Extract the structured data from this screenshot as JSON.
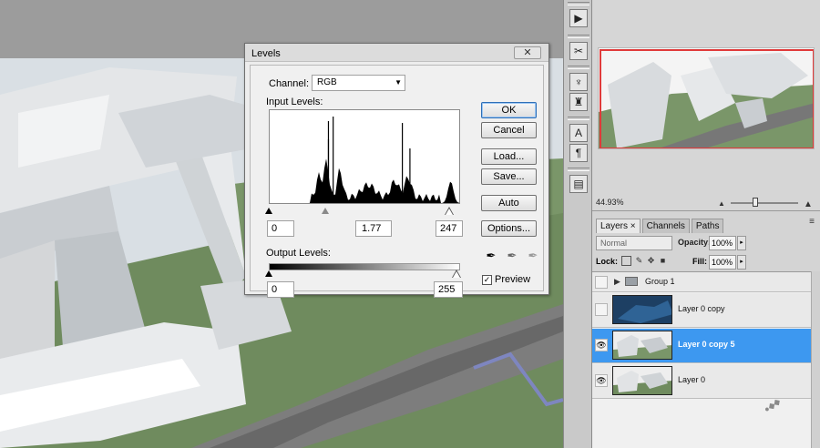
{
  "levels_dialog": {
    "title": "Levels",
    "close_glyph": "✕",
    "channel_label": "Channel:",
    "channel_value": "RGB",
    "input_levels_label": "Input Levels:",
    "input_black": "0",
    "input_gamma": "1.77",
    "input_white": "247",
    "output_levels_label": "Output Levels:",
    "output_black": "0",
    "output_white": "255",
    "buttons": {
      "ok": "OK",
      "cancel": "Cancel",
      "load": "Load...",
      "save": "Save...",
      "auto": "Auto",
      "options": "Options..."
    },
    "preview_label": "Preview",
    "preview_checked": "✓"
  },
  "navigator": {
    "zoom": "44.93%"
  },
  "layers_panel": {
    "tabs": [
      "Layers ×",
      "Channels",
      "Paths"
    ],
    "menu_glyph": "≡",
    "blend_mode": "Normal",
    "opacity_label": "Opacity:",
    "opacity_value": "100%",
    "lock_label": "Lock:",
    "fill_label": "Fill:",
    "fill_value": "100%",
    "layers": [
      {
        "name": "Group 1",
        "visible": false,
        "type": "group"
      },
      {
        "name": "Layer 0 copy",
        "visible": false,
        "type": "layer"
      },
      {
        "name": "Layer 0 copy 5",
        "visible": true,
        "type": "layer",
        "selected": true
      },
      {
        "name": "Layer 0",
        "visible": true,
        "type": "layer"
      }
    ]
  },
  "colors": {
    "selected_layer": "#3d98f0",
    "navigator_view_box": "#e03a3a"
  },
  "icons": [
    "eyedropper-black-icon",
    "eyedropper-gray-icon",
    "eyedropper-white-icon",
    "eye-icon",
    "folder-icon",
    "lock-icon",
    "brush-icon",
    "move-icon",
    "text-tool-icon",
    "paragraph-icon"
  ]
}
